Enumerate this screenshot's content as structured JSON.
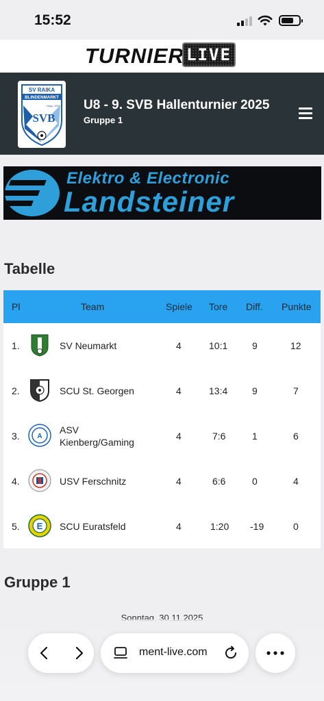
{
  "status_bar": {
    "time": "15:52",
    "battery_level": 0.7
  },
  "brand": {
    "name": "TURNIER",
    "badge": "LIVE"
  },
  "header": {
    "title": "U8 - 9. SVB Hallenturnier 2025",
    "subtitle": "Gruppe 1",
    "logo_text_top": "SV RAIKA",
    "logo_text_mid": "BLINDENMARKT",
    "logo_letters": "SVB",
    "logo_year": "Gegr. 1947"
  },
  "banner": {
    "line1": "Elektro & Electronic",
    "line2": "Landsteiner"
  },
  "standings": {
    "title": "Tabelle",
    "columns": {
      "pl": "Pl",
      "team": "Team",
      "games": "Spiele",
      "goals": "Tore",
      "diff": "Diff.",
      "points": "Punkte"
    },
    "rows": [
      {
        "pl": "1.",
        "team": "SV Neumarkt",
        "games": "4",
        "goals": "10:1",
        "diff": "9",
        "points": "12",
        "logo_color": "#2e7d32"
      },
      {
        "pl": "2.",
        "team": "SCU St. Georgen",
        "games": "4",
        "goals": "13:4",
        "diff": "9",
        "points": "7",
        "logo_color": "#333333"
      },
      {
        "pl": "3.",
        "team": "ASV Kienberg/Gaming",
        "team_line1": "ASV",
        "team_line2": "Kienberg/Gaming",
        "games": "4",
        "goals": "7:6",
        "diff": "1",
        "points": "6",
        "logo_color": "#1e63b8"
      },
      {
        "pl": "4.",
        "team": "USV Ferschnitz",
        "games": "4",
        "goals": "6:6",
        "diff": "0",
        "points": "4",
        "logo_color": "#c0392b"
      },
      {
        "pl": "5.",
        "team": "SCU Euratsfeld",
        "games": "4",
        "goals": "1:20",
        "diff": "-19",
        "points": "0",
        "logo_color": "#e8d200"
      }
    ]
  },
  "group_section": {
    "title": "Gruppe 1",
    "date": "Sonntag, 30.11.2025"
  },
  "browser": {
    "url": "ment-live.com"
  },
  "colors": {
    "header_bg": "#2a3438",
    "table_header": "#29a3f0",
    "banner_blue": "#2f9fd9"
  }
}
